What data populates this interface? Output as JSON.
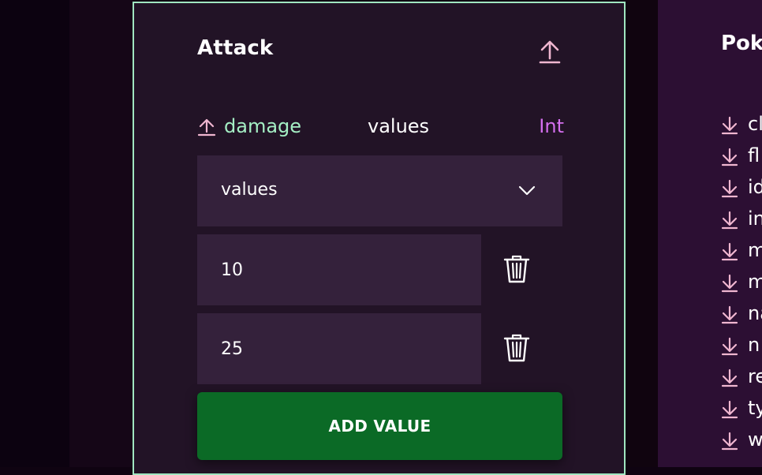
{
  "card": {
    "title": "Attack",
    "field": {
      "name": "damage",
      "kind": "values",
      "type": "Int"
    },
    "select": {
      "selected": "values"
    },
    "values": [
      "10",
      "25"
    ],
    "add_button": "ADD VALUE"
  },
  "right_panel": {
    "title": "Poke",
    "items": [
      "cl",
      "fl",
      "id",
      "in",
      "m",
      "m",
      "na",
      "n",
      "re",
      "ty",
      "w"
    ]
  },
  "colors": {
    "card_border": "#9fe6c0",
    "field_name": "#a4efc4",
    "field_type": "#d56ff0",
    "icon_pink": "#f0b6d0",
    "add_button": "#0b6a26"
  },
  "icons": {
    "card_action": "upload-icon",
    "field": "upload-icon",
    "select": "chevron-down-icon",
    "delete": "trash-icon",
    "right_items": "download-icon"
  }
}
